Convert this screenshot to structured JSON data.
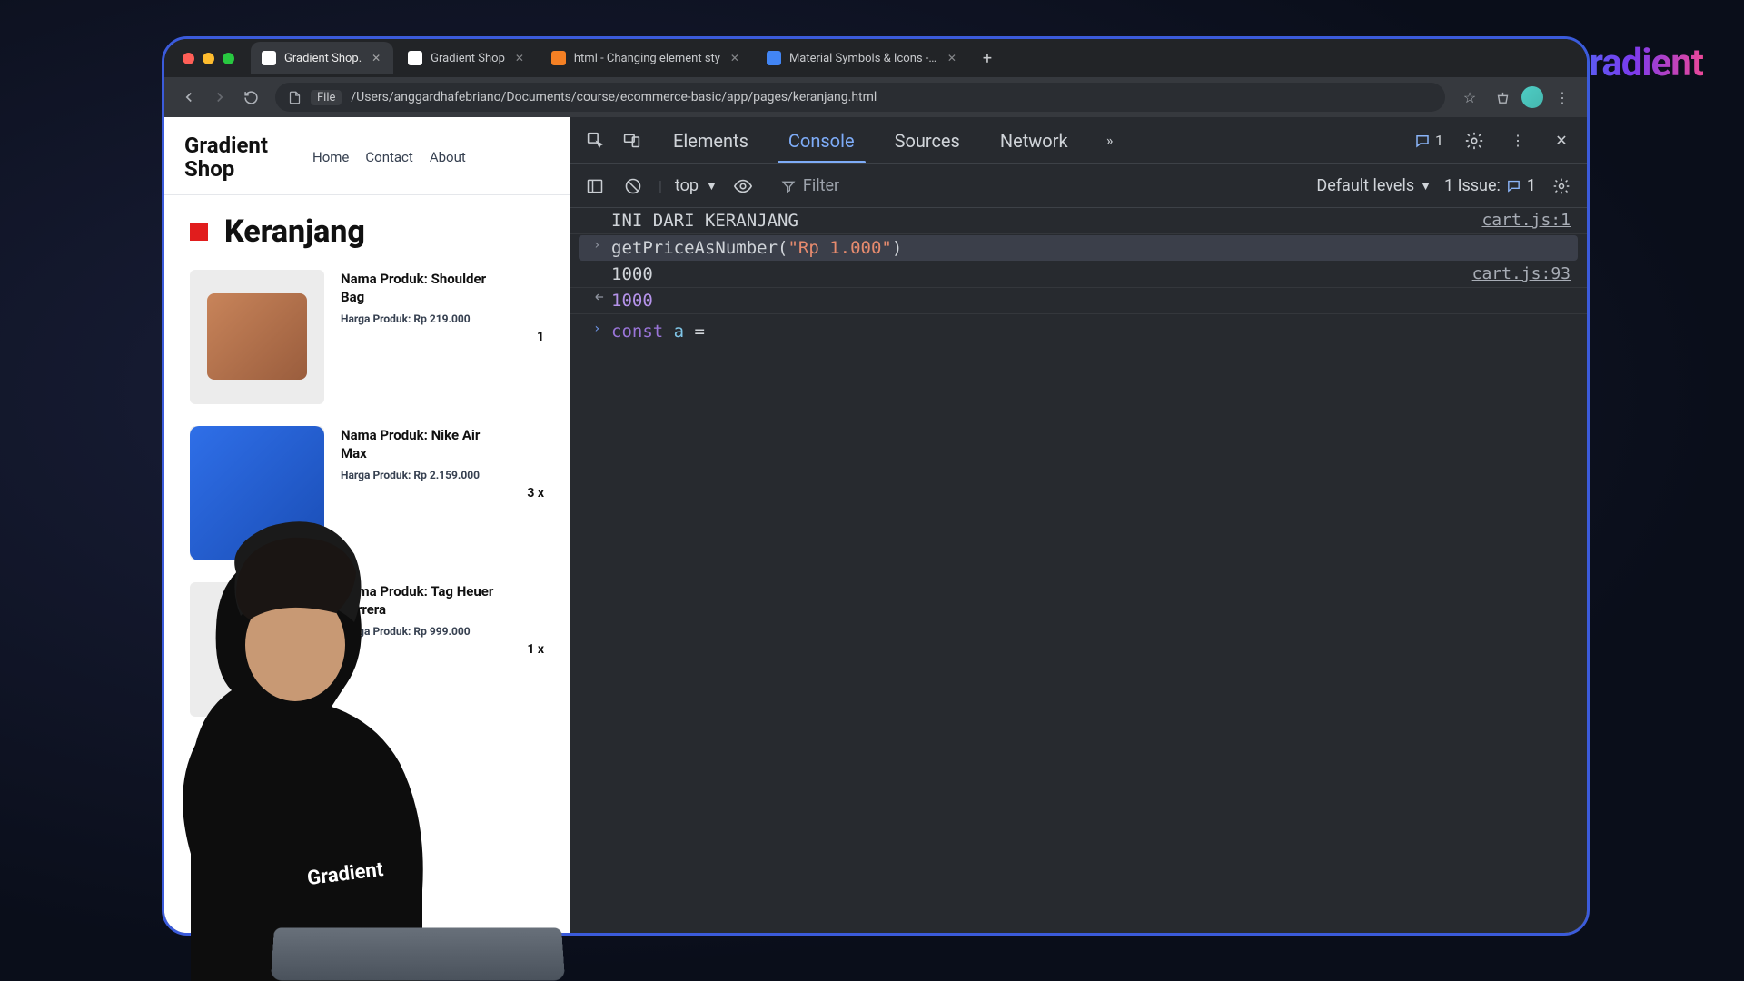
{
  "watermark": "Gradient",
  "browser": {
    "tabs": [
      {
        "label": "Gradient Shop.",
        "active": true
      },
      {
        "label": "Gradient Shop",
        "active": false
      },
      {
        "label": "html - Changing element sty",
        "active": false
      },
      {
        "label": "Material Symbols & Icons - G",
        "active": false
      }
    ],
    "file_chip": "File",
    "url": "/Users/anggardhafebriano/Documents/course/ecommerce-basic/app/pages/keranjang.html"
  },
  "page": {
    "brand": "Gradient Shop",
    "nav": [
      "Home",
      "Contact",
      "About"
    ],
    "heading": "Keranjang",
    "name_prefix": "Nama Produk: ",
    "price_prefix": "Harga Produk: ",
    "items": [
      {
        "name": "Shoulder Bag",
        "price": "Rp 219.000",
        "qty": "1"
      },
      {
        "name": "Nike Air Max",
        "price": "Rp 2.159.000",
        "qty": "3 x"
      },
      {
        "name": "Tag Heuer Carrera",
        "price": "Rp 999.000",
        "qty": "1 x"
      }
    ]
  },
  "devtools": {
    "panels": [
      "Elements",
      "Console",
      "Sources",
      "Network"
    ],
    "active_panel": "Console",
    "msg_count": "1",
    "context": "top",
    "filter_placeholder": "Filter",
    "levels": "Default levels",
    "issues_label": "1 Issue:",
    "issues_count": "1",
    "log": {
      "line1_msg": "INI DARI KERANJANG",
      "line1_src": "cart.js:1",
      "line2_fn": "getPriceAsNumber",
      "line2_arg": "\"Rp 1.000\"",
      "line3_msg": "1000",
      "line3_src": "cart.js:93",
      "line4_ret": "1000",
      "line5_kw": "const",
      "line5_id": "a",
      "line5_rest": " = "
    }
  },
  "shirt": "Gradient"
}
